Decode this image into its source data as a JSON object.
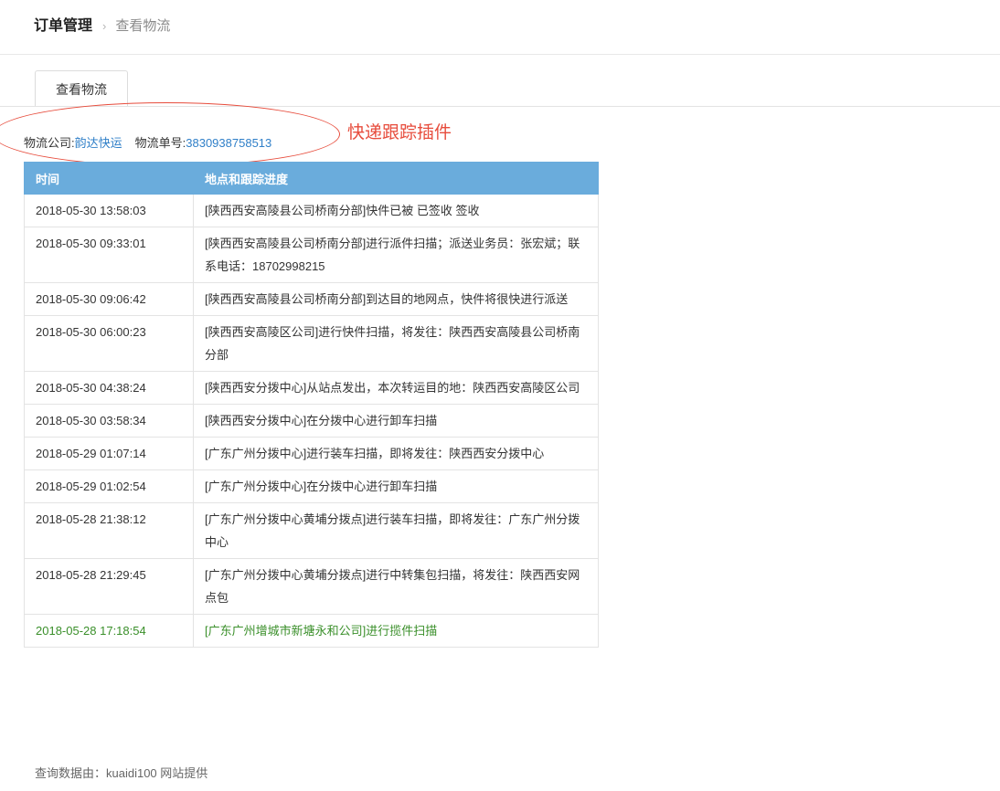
{
  "breadcrumb": {
    "root": "订单管理",
    "separator": "›",
    "current": "查看物流"
  },
  "tabs": [
    {
      "label": "查看物流"
    }
  ],
  "annotation": {
    "text": "快递跟踪插件"
  },
  "logistics": {
    "company_label": "物流公司:",
    "company": "韵达快运",
    "number_label": "物流单号:",
    "number": "3830938758513"
  },
  "table": {
    "headers": [
      "时间",
      "地点和跟踪进度"
    ],
    "rows": [
      {
        "time": "2018-05-30 13:58:03",
        "desc": "[陕西西安高陵县公司桥南分部]快件已被 已签收 签收"
      },
      {
        "time": "2018-05-30 09:33:01",
        "desc": "[陕西西安高陵县公司桥南分部]进行派件扫描；派送业务员：张宏斌；联系电话：18702998215"
      },
      {
        "time": "2018-05-30 09:06:42",
        "desc": "[陕西西安高陵县公司桥南分部]到达目的地网点，快件将很快进行派送"
      },
      {
        "time": "2018-05-30 06:00:23",
        "desc": "[陕西西安高陵区公司]进行快件扫描，将发往：陕西西安高陵县公司桥南分部"
      },
      {
        "time": "2018-05-30 04:38:24",
        "desc": "[陕西西安分拨中心]从站点发出，本次转运目的地：陕西西安高陵区公司"
      },
      {
        "time": "2018-05-30 03:58:34",
        "desc": "[陕西西安分拨中心]在分拨中心进行卸车扫描"
      },
      {
        "time": "2018-05-29 01:07:14",
        "desc": "[广东广州分拨中心]进行装车扫描，即将发往：陕西西安分拨中心"
      },
      {
        "time": "2018-05-29 01:02:54",
        "desc": "[广东广州分拨中心]在分拨中心进行卸车扫描"
      },
      {
        "time": "2018-05-28 21:38:12",
        "desc": "[广东广州分拨中心黄埔分拨点]进行装车扫描，即将发往：广东广州分拨中心"
      },
      {
        "time": "2018-05-28 21:29:45",
        "desc": "[广东广州分拨中心黄埔分拨点]进行中转集包扫描，将发往：陕西西安网点包"
      },
      {
        "time": "2018-05-28 17:18:54",
        "desc": "[广东广州增城市新塘永和公司]进行揽件扫描",
        "latest": true
      }
    ]
  },
  "footer": {
    "text": "查询数据由：kuaidi100 网站提供"
  },
  "colors": {
    "header_bg": "#6aacdc",
    "link": "#2f7fc8",
    "annotation": "#e74c3c",
    "latest": "#3a8f2a"
  }
}
